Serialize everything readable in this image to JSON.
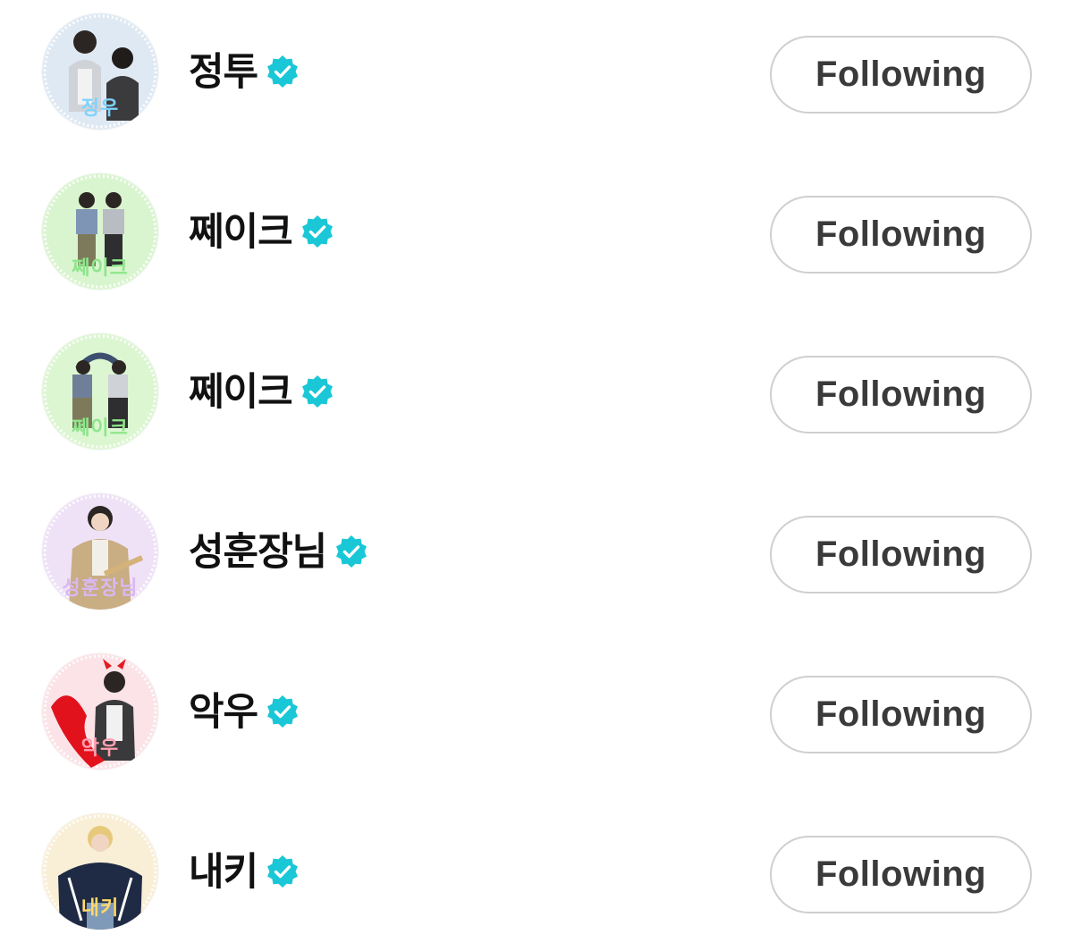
{
  "accent_color": "#1ac7d6",
  "follow_button_label": "Following",
  "accounts": [
    {
      "name": "정투",
      "avatar_caption": "정우",
      "avatar_tint": "#dfe9f3",
      "caption_color": "#7fd3ff",
      "verified": true,
      "verified_icon": "verified-badge-icon"
    },
    {
      "name": "쩨이크",
      "avatar_caption": "쩨이크",
      "avatar_tint": "#d9f5cf",
      "caption_color": "#8ee68a",
      "verified": true,
      "verified_icon": "verified-badge-icon"
    },
    {
      "name": "쩨이크",
      "avatar_caption": "쩨이크",
      "avatar_tint": "#dcf6d2",
      "caption_color": "#8ee68a",
      "verified": true,
      "verified_icon": "verified-badge-icon"
    },
    {
      "name": "성훈장님",
      "avatar_caption": "성훈장님",
      "avatar_tint": "#efe2f7",
      "caption_color": "#d9b8f2",
      "verified": true,
      "verified_icon": "verified-badge-icon"
    },
    {
      "name": "악우",
      "avatar_caption": "악우",
      "avatar_tint": "#fbe3e7",
      "caption_color": "#ff9fb0",
      "verified": true,
      "verified_icon": "verified-badge-icon"
    },
    {
      "name": "내키",
      "avatar_caption": "내키",
      "avatar_tint": "#f9efd6",
      "caption_color": "#ffd96a",
      "verified": true,
      "verified_icon": "verified-badge-icon"
    }
  ]
}
